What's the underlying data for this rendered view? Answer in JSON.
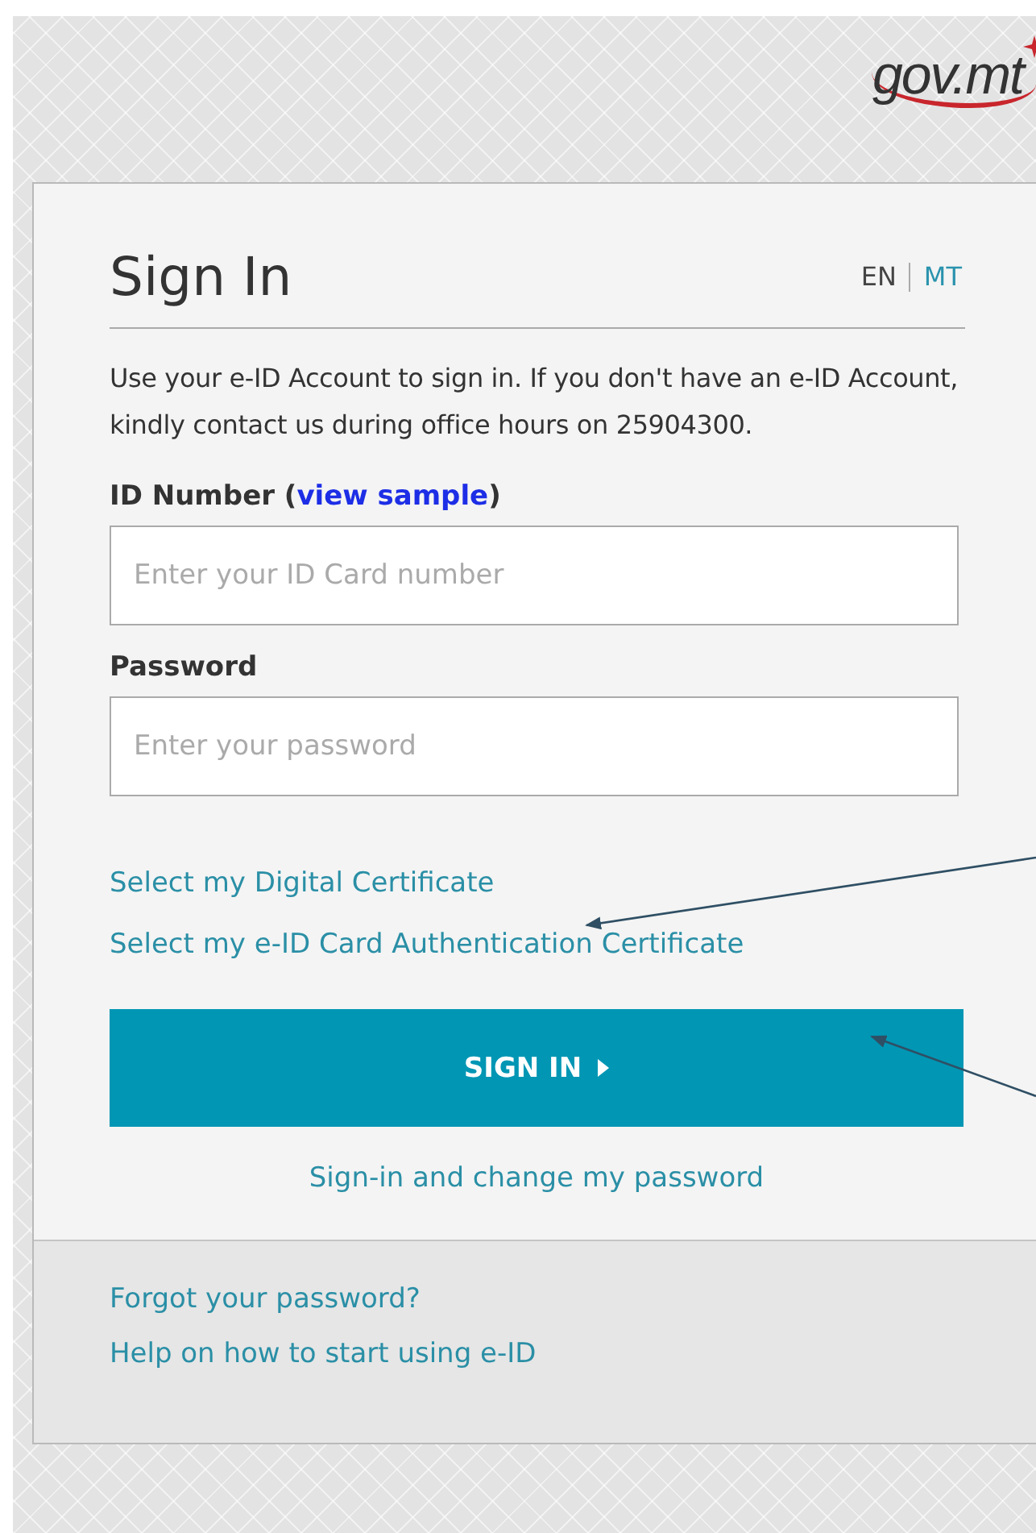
{
  "logo": {
    "text": "gov.mt"
  },
  "title": "Sign In",
  "languages": [
    {
      "label": "EN",
      "selected": true
    },
    {
      "label": "MT",
      "selected": false
    }
  ],
  "intro": "Use your e-ID Account to sign in. If you don't have an e-ID Account, kindly contact us during office hours on 25904300.",
  "fields": [
    {
      "label": "ID Number",
      "link_open": "(",
      "link": "view sample",
      "link_close": ")",
      "placeholder": "Enter your ID Card number"
    },
    {
      "label": "Password",
      "placeholder": "Enter your password"
    }
  ],
  "certificate_links": [
    "Select my Digital Certificate",
    "Select my e-ID Card Authentication Certificate"
  ],
  "sign_in_button": "SIGN IN",
  "change_password_link": "Sign-in and change my password",
  "footer_links": [
    "Forgot your password?",
    "Help on how to start using e-ID"
  ]
}
